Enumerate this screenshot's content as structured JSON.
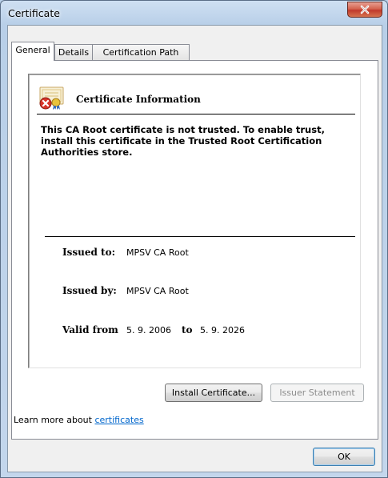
{
  "window": {
    "title": "Certificate"
  },
  "tabs": [
    {
      "label": "General"
    },
    {
      "label": "Details"
    },
    {
      "label": "Certification Path"
    }
  ],
  "info": {
    "heading": "Certificate Information",
    "warning": "This CA Root certificate is not trusted. To enable trust, install this certificate in the Trusted Root Certification Authorities store.",
    "issued_to_label": "Issued to:",
    "issued_to_value": "MPSV CA Root",
    "issued_by_label": "Issued by:",
    "issued_by_value": "MPSV CA Root",
    "valid_from_label": "Valid from",
    "valid_from_value": "5. 9. 2006",
    "valid_to_label": "to",
    "valid_to_value": "5. 9. 2026"
  },
  "buttons": {
    "install": "Install Certificate...",
    "issuer_statement": "Issuer Statement",
    "ok": "OK"
  },
  "learn_more": {
    "prefix": "Learn more about ",
    "link": "certificates"
  },
  "colors": {
    "link": "#0066cc",
    "close_button": "#c0392b"
  }
}
